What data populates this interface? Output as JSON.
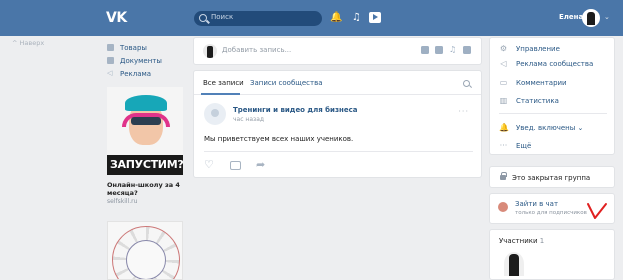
{
  "header": {
    "logo": "VK",
    "search_placeholder": "Поиск",
    "user_name": "Елена",
    "user_caret": "⌄",
    "bell_glyph": "🔔",
    "music_glyph": "♫"
  },
  "left": {
    "back_link": "^ Наверх",
    "nav": [
      {
        "label": "Товары",
        "icon": "goods-icon"
      },
      {
        "label": "Документы",
        "icon": "document-icon"
      },
      {
        "label": "Реклама",
        "icon": "ad-icon"
      }
    ],
    "ad": {
      "banner": "ЗАПУСТИМ?",
      "title": "Онлайн-школу за 4 месяца?",
      "domain": "selfskill.ru"
    }
  },
  "composer": {
    "placeholder": "Добавить запись..."
  },
  "feed": {
    "tabs": [
      {
        "label": "Все записи"
      },
      {
        "label": "Записи сообщества"
      }
    ],
    "post": {
      "author": "Тренинги и видео для бизнеса",
      "time": "час назад",
      "more": "···",
      "text": "Мы приветствуем всех наших учеников."
    }
  },
  "right": {
    "menu": [
      {
        "label": "Управление",
        "icon": "gear-icon",
        "glyph": "⚙"
      },
      {
        "label": "Реклама сообщества",
        "icon": "megaphone-icon",
        "glyph": "◁"
      },
      {
        "label": "Комментарии",
        "icon": "comment-icon",
        "glyph": "▭"
      },
      {
        "label": "Статистика",
        "icon": "stats-icon",
        "glyph": "▥"
      }
    ],
    "notify": {
      "label": "Увед. включены ⌄",
      "icon": "bell-icon",
      "glyph": "🔔"
    },
    "more": {
      "label": "Ещё",
      "glyph": "···"
    },
    "closed_group": "Это закрытая группа",
    "chat": {
      "title": "Зайти в чат",
      "subtitle": "только для подписчиков"
    },
    "members": {
      "title": "Участники",
      "count": "1"
    }
  },
  "colors": {
    "header": "#4a76a8",
    "link": "#2a5885",
    "check_mark": "#e02020"
  }
}
